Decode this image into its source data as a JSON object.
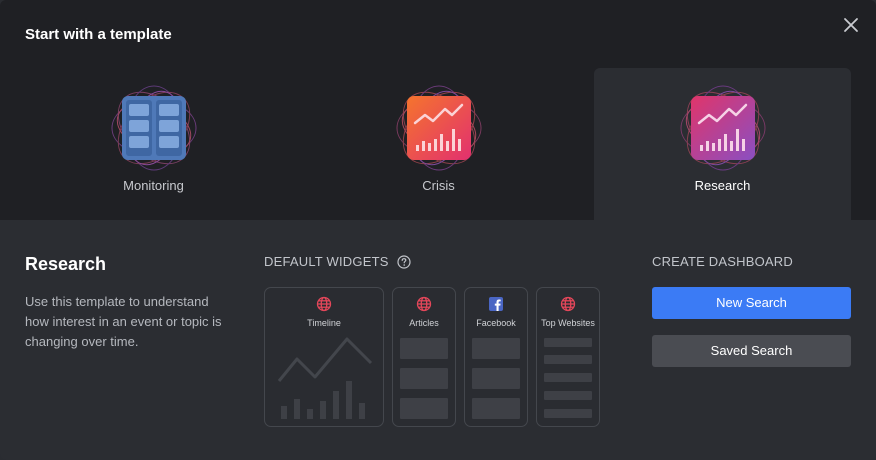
{
  "dialog": {
    "title": "Start with a template",
    "close_icon": "close-icon"
  },
  "templates": [
    {
      "label": "Monitoring",
      "icon": "monitoring-icon",
      "selected": false
    },
    {
      "label": "Crisis",
      "icon": "crisis-icon",
      "selected": false
    },
    {
      "label": "Research",
      "icon": "research-icon",
      "selected": true
    }
  ],
  "details": {
    "title": "Research",
    "description": "Use this template to understand how interest in an event or topic is changing over time."
  },
  "widgets": {
    "heading": "DEFAULT WIDGETS",
    "help_icon": "help-icon",
    "items": [
      {
        "label": "Timeline",
        "icon": "globe-icon"
      },
      {
        "label": "Articles",
        "icon": "globe-icon"
      },
      {
        "label": "Facebook",
        "icon": "facebook-icon"
      },
      {
        "label": "Top Websites",
        "icon": "globe-icon"
      }
    ]
  },
  "create": {
    "heading": "CREATE DASHBOARD",
    "new_search": "New Search",
    "saved_search": "Saved Search"
  },
  "colors": {
    "primary": "#3b7bf5",
    "globe": "#e5475a",
    "facebook": "#4a66c4"
  }
}
